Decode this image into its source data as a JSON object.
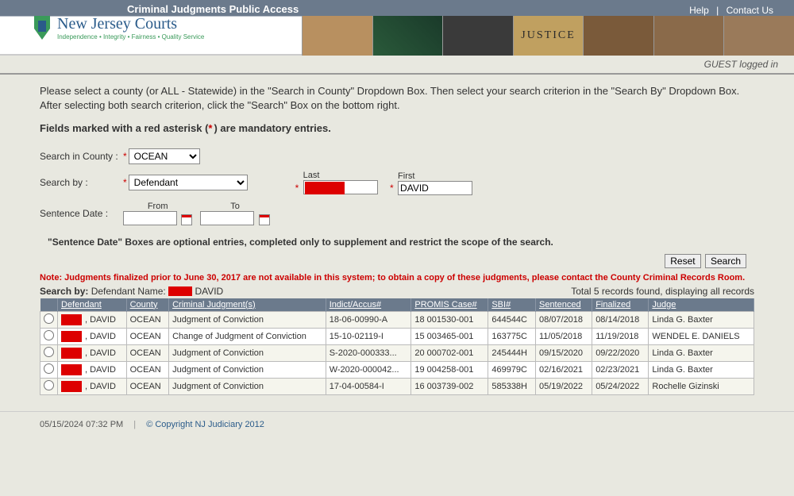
{
  "header": {
    "app_title": "Criminal Judgments Public Access",
    "help_link": "Help",
    "contact_link": "Contact Us",
    "logo_main": "New Jersey Courts",
    "logo_tag": "Independence • Integrity • Fairness • Quality Service",
    "justice_word": "JUSTICE"
  },
  "login_status": "GUEST logged in",
  "instructions": "Please select a county (or ALL - Statewide) in the \"Search in County\" Dropdown Box. Then select your search criterion in the \"Search By\" Dropdown Box. After selecting both search criterion, click the \"Search\" Box on the bottom right.",
  "mandatory_prefix": "Fields marked with a red asterisk (",
  "mandatory_suffix": ") are mandatory entries.",
  "form": {
    "county_label": "Search in County :",
    "county_value": "OCEAN",
    "searchby_label": "Search by :",
    "searchby_value": "Defendant",
    "last_label": "Last",
    "last_value": "",
    "first_label": "First",
    "first_value": "DAVID",
    "sentence_label": "Sentence Date :",
    "from_label": "From",
    "to_label": "To",
    "from_value": "",
    "to_value": ""
  },
  "sentence_note": "\"Sentence Date\" Boxes are optional entries, completed only to supplement and restrict the scope of the search.",
  "buttons": {
    "reset": "Reset",
    "search": "Search"
  },
  "note_red": "Note: Judgments finalized prior to June 30, 2017 are not available in this system; to obtain a copy of these judgments, please contact the County Criminal Records Room.",
  "results_header": {
    "searchby_label": "Search by:",
    "searchby_value_prefix": "Defendant Name: ",
    "searchby_name_last": "",
    "searchby_name_first": " DAVID",
    "count_text": "Total 5 records found, displaying all records"
  },
  "columns": {
    "defendant": "Defendant",
    "county": "County",
    "crim_judg": "Criminal Judgment(s)",
    "indict": "Indict/Accus#",
    "promis": "PROMIS Case#",
    "sbi": "SBI#",
    "sentenced": "Sentenced",
    "finalized": "Finalized",
    "judge": "Judge"
  },
  "rows": [
    {
      "defendant_first": "DAVID",
      "county": "OCEAN",
      "judgment": "Judgment of Conviction",
      "indict": "18-06-00990-A",
      "promis": "18 001530-001",
      "sbi": "644544C",
      "sentenced": "08/07/2018",
      "finalized": "08/14/2018",
      "judge": "Linda G. Baxter"
    },
    {
      "defendant_first": "DAVID",
      "county": "OCEAN",
      "judgment": "Change of Judgment of Conviction",
      "indict": "15-10-02119-I",
      "promis": "15 003465-001",
      "sbi": "163775C",
      "sentenced": "11/05/2018",
      "finalized": "11/19/2018",
      "judge": "WENDEL E. DANIELS"
    },
    {
      "defendant_first": "DAVID",
      "county": "OCEAN",
      "judgment": "Judgment of Conviction",
      "indict": "S-2020-000333...",
      "promis": "20 000702-001",
      "sbi": "245444H",
      "sentenced": "09/15/2020",
      "finalized": "09/22/2020",
      "judge": "Linda G. Baxter"
    },
    {
      "defendant_first": "DAVID",
      "county": "OCEAN",
      "judgment": "Judgment of Conviction",
      "indict": "W-2020-000042...",
      "promis": "19 004258-001",
      "sbi": "469979C",
      "sentenced": "02/16/2021",
      "finalized": "02/23/2021",
      "judge": "Linda G. Baxter"
    },
    {
      "defendant_first": "DAVID",
      "county": "OCEAN",
      "judgment": "Judgment of Conviction",
      "indict": "17-04-00584-I",
      "promis": "16 003739-002",
      "sbi": "585338H",
      "sentenced": "05/19/2022",
      "finalized": "05/24/2022",
      "judge": "Rochelle Gizinski"
    }
  ],
  "footer": {
    "timestamp": "05/15/2024 07:32 PM",
    "copyright": "© Copyright NJ Judiciary 2012"
  }
}
